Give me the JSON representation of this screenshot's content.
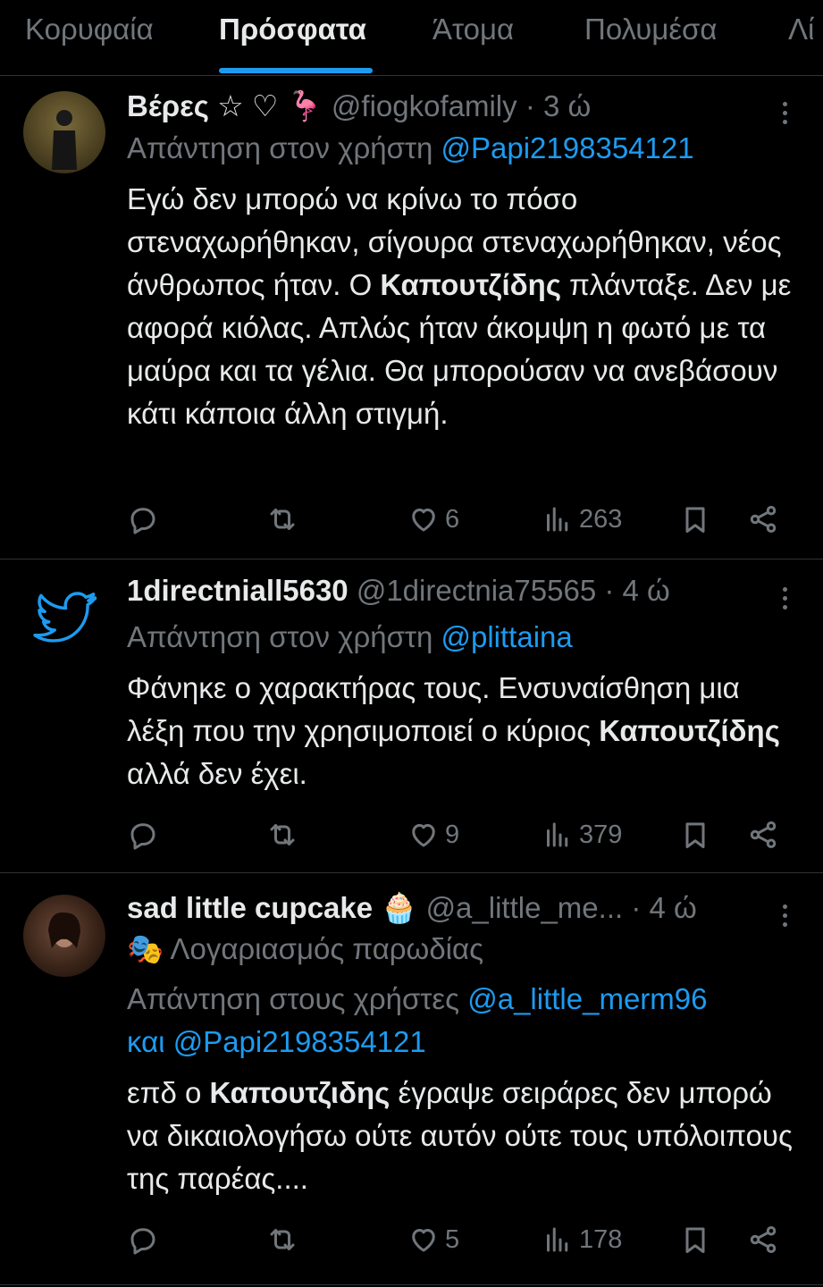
{
  "tabs": [
    {
      "label": "Κορυφαία",
      "active": false
    },
    {
      "label": "Πρόσφατα",
      "active": true
    },
    {
      "label": "Άτομα",
      "active": false
    },
    {
      "label": "Πολυμέσα",
      "active": false
    },
    {
      "label": "Λί",
      "active": false
    }
  ],
  "tweets": [
    {
      "name": "Βέρες ☆ ♡ 🦩",
      "handle": "@fiogkofamily",
      "time": "· 3 ώ",
      "reply_prefix": "Απάντηση στον χρήστη",
      "reply_to": "@Papi2198354121",
      "text_parts": [
        "Εγώ δεν μπορώ να κρίνω το πόσο στεναχωρήθηκαν, σίγουρα στεναχωρήθηκαν, νέος άνθρωπος ήταν. Ο ",
        "Καπουτζίδης",
        " πλάνταξε. Δεν με αφορά κιόλας. Απλώς ήταν άκομψη η φωτό με τα μαύρα και τα γέλια. Θα μπορούσαν να ανεβάσουν κάτι κάποια άλλη στιγμή."
      ],
      "likes": "6",
      "views": "263"
    },
    {
      "name": "1directniall5630",
      "handle": "@1directnia75565",
      "time": "· 4 ώ",
      "reply_prefix": "Απάντηση στον χρήστη",
      "reply_to": "@plittaina",
      "text_parts": [
        "Φάνηκε ο χαρακτήρας τους. Ενσυναίσθηση μια λέξη που την χρησιμοποιεί ο κύριος ",
        "Καπουτζίδης",
        " αλλά δεν έχει."
      ],
      "likes": "9",
      "views": "379"
    },
    {
      "name": "sad little cupcake 🧁",
      "handle": "@a_little_me...",
      "time": "· 4 ώ",
      "badge": "🎭 Λογαριασμός παρωδίας",
      "reply_prefix": "Απάντηση στους χρήστες",
      "reply_to": "@a_little_merm96",
      "reply_and": "και",
      "reply_to_2": "@Papi2198354121",
      "text_parts": [
        "επδ ο ",
        "Καπουτζιδης",
        " έγραψε σειράρες δεν μπορώ να δικαιολογήσω ούτε αυτόν ούτε τους υπόλοιπους της παρέας...."
      ],
      "likes": "5",
      "views": "178"
    }
  ],
  "colors": {
    "accent": "#1d9bf0",
    "muted": "#71767b",
    "text": "#e7e9ea",
    "background": "#000000"
  }
}
